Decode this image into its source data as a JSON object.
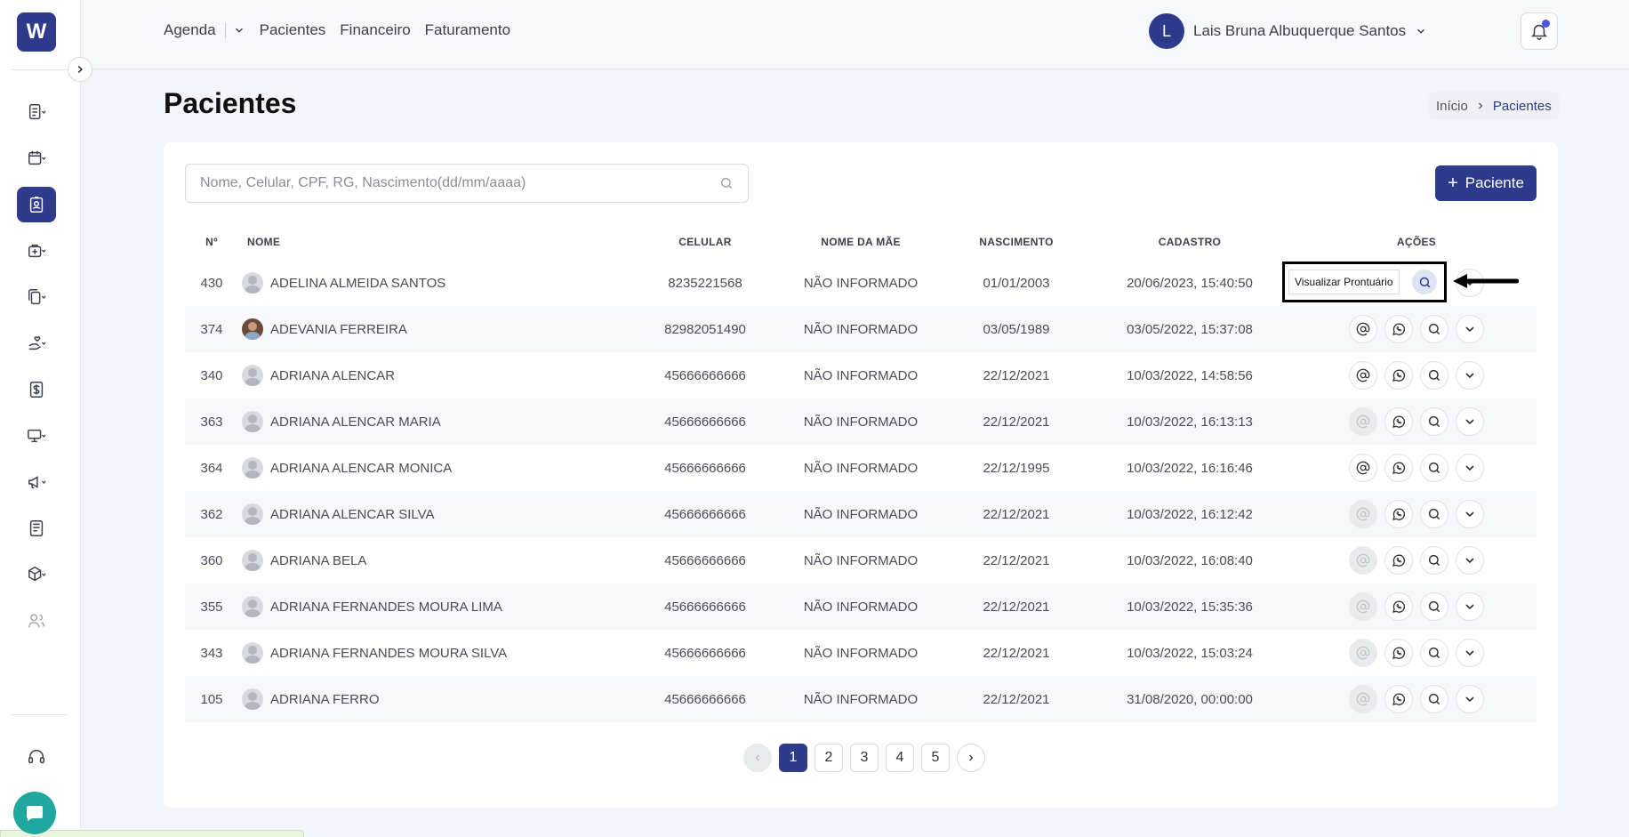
{
  "app": {
    "logo_text": "W"
  },
  "topnav": {
    "items": [
      "Agenda",
      "Pacientes",
      "Financeiro",
      "Faturamento"
    ]
  },
  "user": {
    "initial": "L",
    "name": "Lais Bruna Albuquerque Santos"
  },
  "page": {
    "title": "Pacientes",
    "breadcrumb": {
      "home": "Início",
      "current": "Pacientes"
    }
  },
  "search": {
    "placeholder": "Nome, Celular, CPF, RG, Nascimento(dd/mm/aaaa)",
    "value": ""
  },
  "add_button": {
    "plus": "+",
    "label": "Paciente"
  },
  "table": {
    "headers": {
      "no": "Nº",
      "name": "NOME",
      "cel": "CELULAR",
      "mae": "NOME DA MÃE",
      "nasc": "NASCIMENTO",
      "cad": "CADASTRO",
      "act": "AÇÕES"
    },
    "rows": [
      {
        "no": "430",
        "name": "ADELINA ALMEIDA SANTOS",
        "cel": "8235221568",
        "mae": "NÃO INFORMADO",
        "nasc": "01/01/2003",
        "cad": "20/06/2023, 15:40:50"
      },
      {
        "no": "374",
        "name": "ADEVANIA FERREIRA",
        "cel": "82982051490",
        "mae": "NÃO INFORMADO",
        "nasc": "03/05/1989",
        "cad": "03/05/2022, 15:37:08"
      },
      {
        "no": "340",
        "name": "ADRIANA ALENCAR",
        "cel": "45666666666",
        "mae": "NÃO INFORMADO",
        "nasc": "22/12/2021",
        "cad": "10/03/2022, 14:58:56"
      },
      {
        "no": "363",
        "name": "ADRIANA ALENCAR MARIA",
        "cel": "45666666666",
        "mae": "NÃO INFORMADO",
        "nasc": "22/12/2021",
        "cad": "10/03/2022, 16:13:13"
      },
      {
        "no": "364",
        "name": "ADRIANA ALENCAR MONICA",
        "cel": "45666666666",
        "mae": "NÃO INFORMADO",
        "nasc": "22/12/1995",
        "cad": "10/03/2022, 16:16:46"
      },
      {
        "no": "362",
        "name": "ADRIANA ALENCAR SILVA",
        "cel": "45666666666",
        "mae": "NÃO INFORMADO",
        "nasc": "22/12/2021",
        "cad": "10/03/2022, 16:12:42"
      },
      {
        "no": "360",
        "name": "ADRIANA BELA",
        "cel": "45666666666",
        "mae": "NÃO INFORMADO",
        "nasc": "22/12/2021",
        "cad": "10/03/2022, 16:08:40"
      },
      {
        "no": "355",
        "name": "ADRIANA FERNANDES MOURA LIMA",
        "cel": "45666666666",
        "mae": "NÃO INFORMADO",
        "nasc": "22/12/2021",
        "cad": "10/03/2022, 15:35:36"
      },
      {
        "no": "343",
        "name": "ADRIANA FERNANDES MOURA SILVA",
        "cel": "45666666666",
        "mae": "NÃO INFORMADO",
        "nasc": "22/12/2021",
        "cad": "10/03/2022, 15:03:24"
      },
      {
        "no": "105",
        "name": "ADRIANA FERRO",
        "cel": "45666666666",
        "mae": "NÃO INFORMADO",
        "nasc": "22/12/2021",
        "cad": "31/08/2020, 00:00:00"
      }
    ]
  },
  "tooltip": {
    "label": "Visualizar Prontuário"
  },
  "pagination": {
    "pages": [
      "1",
      "2",
      "3",
      "4",
      "5"
    ],
    "current": "1"
  }
}
